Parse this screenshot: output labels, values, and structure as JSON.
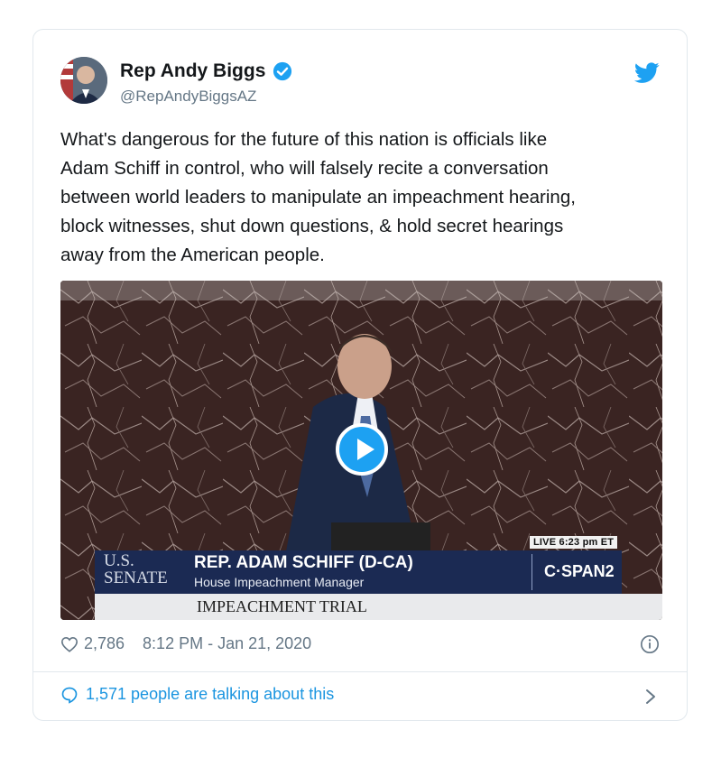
{
  "author": {
    "name": "Rep Andy Biggs",
    "handle": "@RepAndyBiggsAZ",
    "verified": true,
    "avatar_icon": "profile-photo"
  },
  "tweet": {
    "text": "What's dangerous for the future of this nation is officials like\nAdam Schiff in control, who will falsely recite a conversation\nbetween world leaders to manipulate an impeachment hearing,\nblock witnesses, shut down questions, & hold secret hearings\naway from the American people."
  },
  "media": {
    "type": "video",
    "live_badge": "LIVE  6:23 pm ET",
    "senate_line1": "U.S.",
    "senate_line2": "SENATE",
    "chyron_name": "REP. ADAM SCHIFF (D-CA)",
    "chyron_role": "House Impeachment Manager",
    "network": "C·SPAN2",
    "trial_label": "IMPEACHMENT TRIAL"
  },
  "meta": {
    "likes": "2,786",
    "timestamp": "8:12 PM - Jan 21, 2020"
  },
  "conversation": {
    "label": "1,571 people are talking about this"
  },
  "colors": {
    "accent": "#1da1f2",
    "link": "#1b95e0",
    "muted": "#657786",
    "chyron": "#1b2a53"
  }
}
